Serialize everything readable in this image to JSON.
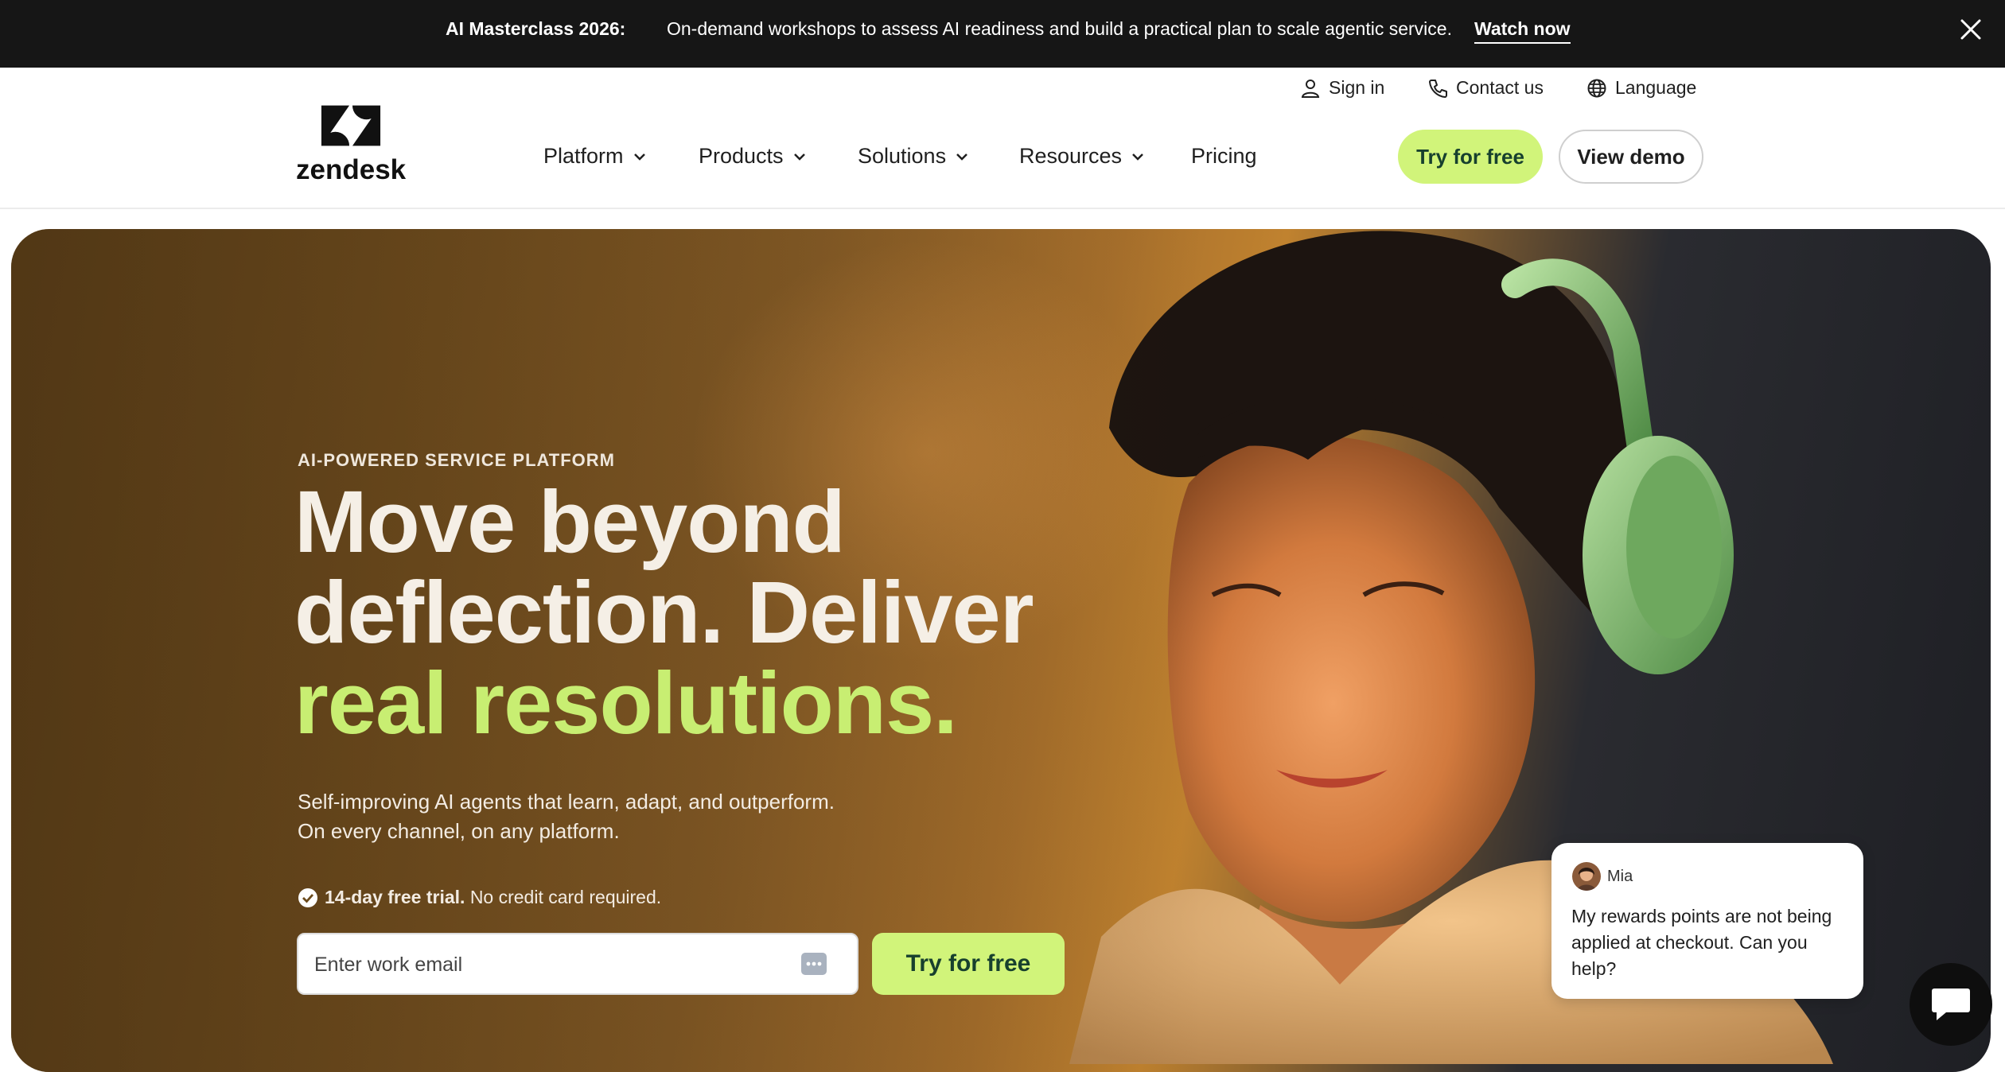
{
  "promo": {
    "title": "AI Masterclass 2026:",
    "text": "On-demand workshops to assess AI readiness and build a practical plan to scale agentic service.",
    "link": "Watch now",
    "close_icon": "close-icon"
  },
  "utility": {
    "signin": "Sign in",
    "contact": "Contact us",
    "language": "Language"
  },
  "logo": {
    "text": "zendesk"
  },
  "nav": {
    "platform": "Platform",
    "products": "Products",
    "solutions": "Solutions",
    "resources": "Resources",
    "pricing": "Pricing"
  },
  "header_buttons": {
    "try": "Try for free",
    "demo": "View demo"
  },
  "hero": {
    "eyebrow": "AI-POWERED SERVICE PLATFORM",
    "headline_line1": "Move beyond",
    "headline_line2": "deflection. Deliver",
    "headline_line3": "real resolutions.",
    "sub_line1": "Self-improving AI agents that learn, adapt, and outperform.",
    "sub_line2": "On every channel, on any platform.",
    "trial_bold": "14-day free trial.",
    "trial_rest": "No credit card required.",
    "email_placeholder": "Enter work email",
    "cta": "Try for free"
  },
  "chat": {
    "name": "Mia",
    "message": "My rewards points are not being applied at checkout. Can you help?"
  },
  "colors": {
    "accent_green": "#d1f47a",
    "headline_green": "#c8ee72",
    "promo_bg": "#161616"
  }
}
